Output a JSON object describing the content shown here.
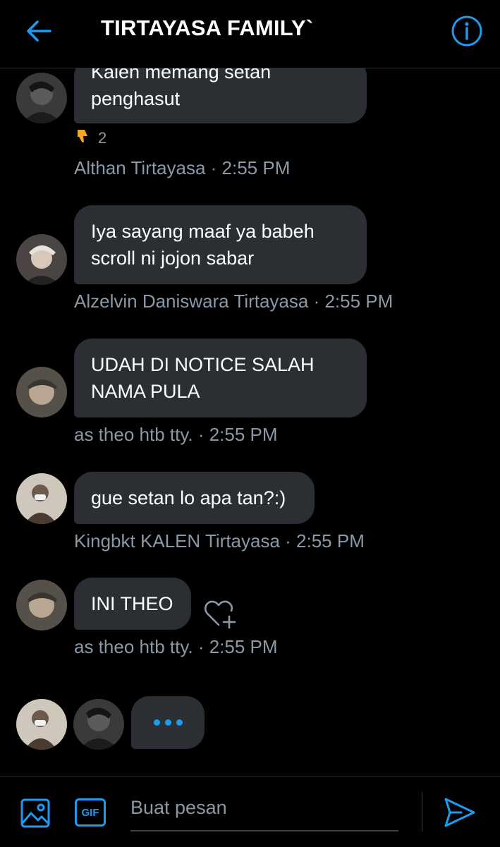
{
  "header": {
    "title": "TIRTAYASA FAMILY`",
    "back_icon": "arrow-left-icon",
    "info_icon": "info-icon",
    "accent_color": "#1d9bf0"
  },
  "messages": [
    {
      "lines": [
        "Kalen memang setan",
        "penghasut"
      ],
      "reaction": {
        "icon": "thumbs-down-emoji",
        "count": "2"
      },
      "meta": "Althan Tirtayasa · 2:55 PM"
    },
    {
      "lines": [
        "Iya sayang maaf ya babeh",
        "scroll ni jojon sabar"
      ],
      "meta": "Alzelvin Daniswara Tirtayasa · 2:55 PM"
    },
    {
      "lines": [
        "UDAH DI NOTICE SALAH",
        "NAMA PULA"
      ],
      "meta": "as theo htb tty. · 2:55 PM"
    },
    {
      "lines": [
        "gue setan lo apa tan?:)"
      ],
      "meta": "Kingbkt KALEN Tirtayasa · 2:55 PM"
    },
    {
      "lines": [
        "INI THEO"
      ],
      "meta": "as theo htb tty. · 2:55 PM"
    }
  ],
  "typing": {
    "indicator": "typing-dots"
  },
  "composer": {
    "placeholder": "Buat pesan",
    "gif_label": "GIF",
    "media_icon": "image-icon",
    "send_icon": "send-icon"
  }
}
